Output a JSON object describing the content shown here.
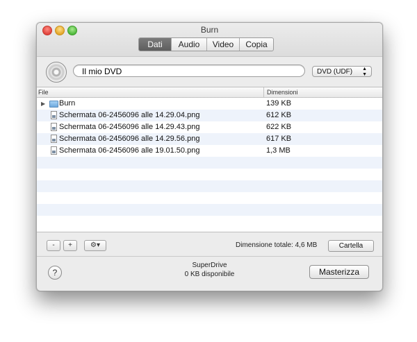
{
  "window": {
    "title": "Burn"
  },
  "tabs": [
    {
      "label": "Dati",
      "active": true
    },
    {
      "label": "Audio",
      "active": false
    },
    {
      "label": "Video",
      "active": false
    },
    {
      "label": "Copia",
      "active": false
    }
  ],
  "disc": {
    "name": "Il mio DVD",
    "format": "DVD (UDF)"
  },
  "list": {
    "columns": {
      "file": "File",
      "size": "Dimensioni"
    },
    "rows": [
      {
        "type": "folder",
        "name": "Burn",
        "size": "139 KB"
      },
      {
        "type": "file",
        "name": "Schermata 06-2456096 alle 14.29.04.png",
        "size": "612 KB"
      },
      {
        "type": "file",
        "name": "Schermata 06-2456096 alle 14.29.43.png",
        "size": "622 KB"
      },
      {
        "type": "file",
        "name": "Schermata 06-2456096 alle 14.29.56.png",
        "size": "617 KB"
      },
      {
        "type": "file",
        "name": "Schermata 06-2456096 alle 19.01.50.png",
        "size": "1,3 MB"
      }
    ]
  },
  "toolbar": {
    "remove_label": "-",
    "add_label": "+",
    "actions_label": "⚙▾",
    "total_size": "Dimensione totale: 4,6 MB",
    "folder_label": "Cartella"
  },
  "footer": {
    "help_label": "?",
    "drive_name": "SuperDrive",
    "drive_free": "0 KB disponibile",
    "burn_label": "Masterizza"
  },
  "colors": {
    "active_tab": "#6b6b6b",
    "alt_row": "#eef3fb"
  }
}
